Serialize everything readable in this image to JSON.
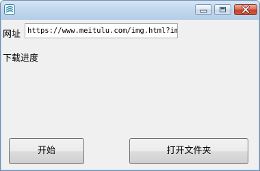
{
  "window": {
    "title": "",
    "app_icon": "app-logo-icon",
    "controls": {
      "minimize_icon": "minimize-icon",
      "maximize_icon": "maximize-icon",
      "close_icon": "close-icon"
    }
  },
  "form": {
    "url_label": "网址",
    "url_value": "https://www.meitulu.com/img.html?img=",
    "progress_label": "下载进度"
  },
  "buttons": {
    "start_label": "开始",
    "open_folder_label": "打开文件夹"
  },
  "colors": {
    "titlebar": "#c2d8ee",
    "client_bg": "#f0f0f0",
    "close_button": "#c4402a"
  }
}
